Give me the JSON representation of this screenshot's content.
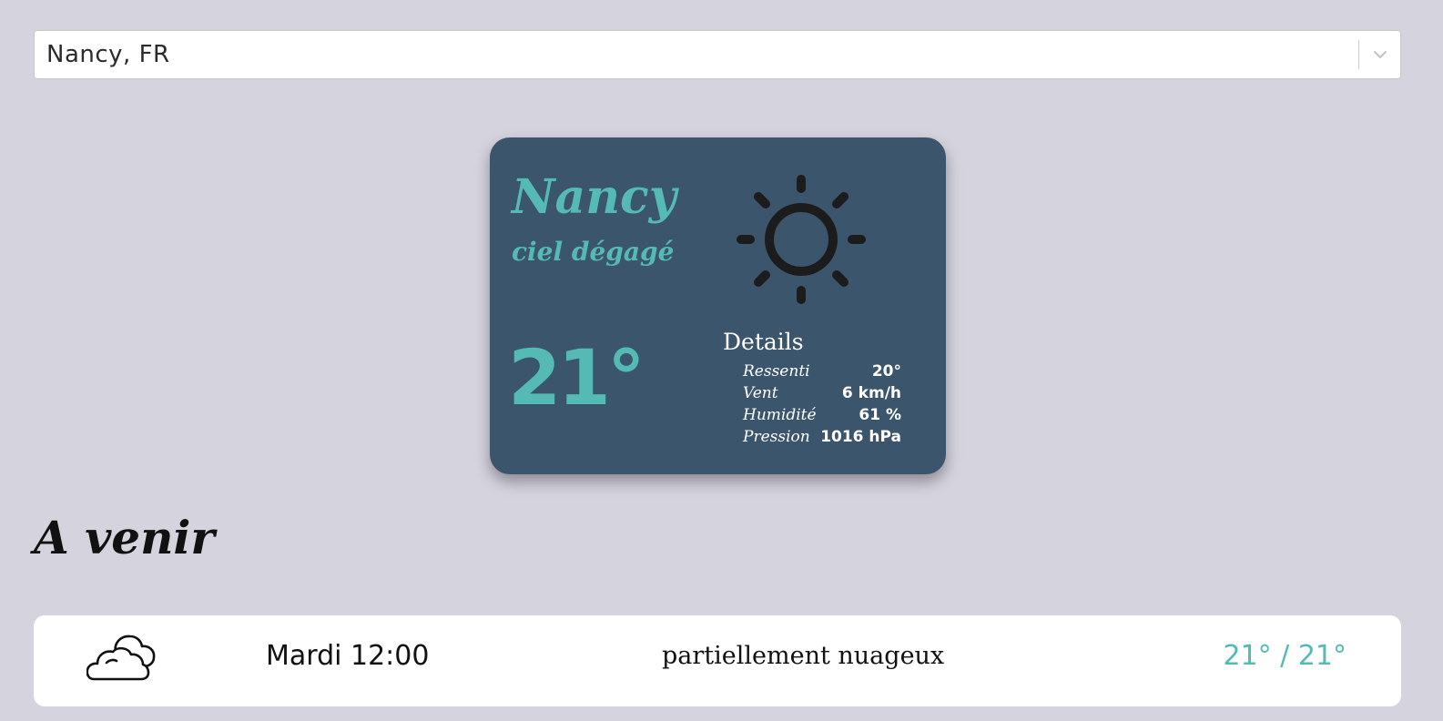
{
  "city_select": {
    "value": "Nancy, FR",
    "dropdown_icon": "chevron-down-icon"
  },
  "current": {
    "city": "Nancy",
    "description": "ciel dégagé",
    "temperature": "21°",
    "icon": "sun-icon",
    "details": {
      "title": "Details",
      "rows": [
        {
          "label": "Ressenti",
          "value": "20°"
        },
        {
          "label": "Vent",
          "value": "6 km/h"
        },
        {
          "label": "Humidité",
          "value": "61 %"
        },
        {
          "label": "Pression",
          "value": "1016 hPa"
        }
      ]
    }
  },
  "upcoming": {
    "title": "A venir",
    "items": [
      {
        "icon": "cloud-icon",
        "time": "Mardi 12:00",
        "description": "partiellement nuageux",
        "temps": "21° / 21°"
      }
    ]
  },
  "colors": {
    "background": "#d5d3dd",
    "card": "#3b556c",
    "accent": "#54bab3",
    "white": "#ffffff"
  }
}
